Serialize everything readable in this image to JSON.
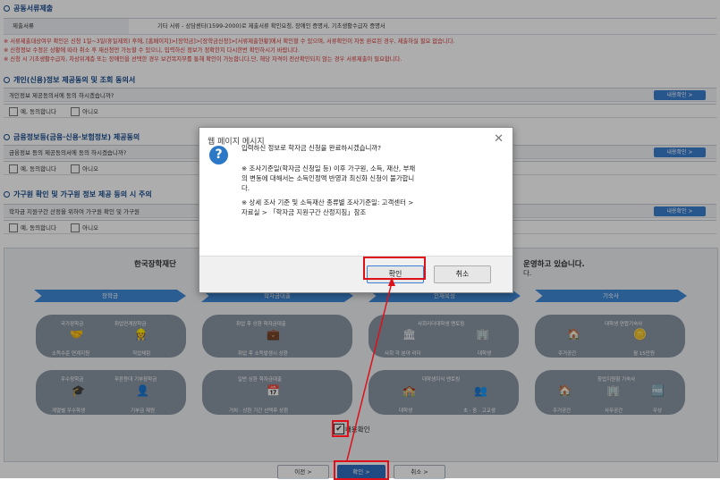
{
  "sections": {
    "docs": {
      "title": "공동서류제출",
      "label": "제출서류",
      "value": "기타 서류 - 상담센터(1599-2000)로 제출서류 확인요청, 장애인 증명서, 기초생활수급자 증명서",
      "notes": [
        "※ 서류제출대상여부 확인은 신청 1일~3일(휴일제외) 후에, [홈페이지]>[장학금]>[장학금신청]>[서류제출현황]에서 확인할 수 있으며, 서류확인이 자동 완료된 경우, 제출하실 필요 없습니다.",
        "※ 신청정보 수정은 상황에 따라 취소 후 재신청만 가능할 수 있으니, 입력하신 정보가 정확한지 다시한번 확인하시기 바랍니다.",
        "※ 신청 시 기초생활수급자, 차상위계층 또는 장애인을 선택한 경우 보건복지부를 통해 확인이 가능합니다.단, 해당 자격이 전산확인되지 않는 경우 서류제출이 필요합니다."
      ]
    },
    "personal": {
      "title": "개인(신용)정보 제공동의 및 조회 동의서",
      "question": "개인정보 제공동의서에 동의 하시겠습니까?",
      "yes": "예, 동의합니다",
      "no": "아니오",
      "confirm": "내용확인 >"
    },
    "finance": {
      "title": "금융정보등(금융·신용·보험정보) 제공동의",
      "question": "금융정보 등의 제공동의서에 동의 하시겠습니까?",
      "yes": "예, 동의합니다",
      "no": "아니오",
      "confirm": "내용확인 >"
    },
    "household": {
      "title": "가구원 확인 및 가구원 정보 제공 등의 시 주의",
      "question": "학자금 지원구간 산정을 위하여 가구원 확인 및 가구원",
      "yes": "예, 동의합니다",
      "no": "아니오",
      "confirm": "내용확인 >"
    }
  },
  "banner": {
    "left_text": "한국장학재단",
    "right_text": "운영하고 있습니다.",
    "right_sub": "다."
  },
  "categories": [
    "장학금",
    "학자금대출",
    "인재육성",
    "기숙사"
  ],
  "cards": [
    {
      "title_a": "국가장학금",
      "title_b": "취업연계장학금",
      "sub_a": "소득수준 연계지원",
      "sub_b": "직업체험"
    },
    {
      "title_a": "취업 후 상환 학자금대출",
      "sub_a": "취업 후 소득발생시 상환"
    },
    {
      "title_a": "사회리더대학생 멘토링",
      "sub_a": "사회 각 분야 리더",
      "sub_b": "대학생"
    },
    {
      "title_a": "대학생 연합기숙사",
      "sub_a": "주거공간",
      "sub_b": "월 15만원"
    },
    {
      "title_a": "우수장학금",
      "title_b": "푸른등대 기부장학금",
      "sub_a": "계열별 우수학생",
      "sub_b": "기부금 재원"
    },
    {
      "title_a": "일반 상환 학자금대출",
      "sub_a": "거치 · 상환 기간 선택후 상환"
    },
    {
      "title_a": "대학생지식 멘토링",
      "sub_a": "대학생",
      "sub_b": "초 · 중 · 고교생"
    },
    {
      "title_a": "창업지원형 기숙사",
      "sub_a": "주거공간",
      "sub_b": "사무공간",
      "sub_c": "무상"
    }
  ],
  "content_check": "내용확인",
  "nav": {
    "prev": "이전 >",
    "confirm": "확인 >",
    "cancel": "취소 >"
  },
  "dialog": {
    "title": "웹 페이지 메시지",
    "close": "✕",
    "icon": "?",
    "line1": "입력하신 정보로 학자금 신청을 완료하시겠습니까?",
    "line2": "※ 조사기준일(학자금 신청일 등) 이후 가구원, 소득, 재산, 부채",
    "line3": "의 변동에 대해서는 소득인정액 반영과 최신화 신청이 불가합니",
    "line4": "다.",
    "line5": "※ 상세 조사 기준 및 소득재산 종류별 조사기준일: 고객센터 >",
    "line6": "자료실 > 「학자금 지원구간 산정지침」참조",
    "ok": "확인",
    "cancel": "취소"
  }
}
